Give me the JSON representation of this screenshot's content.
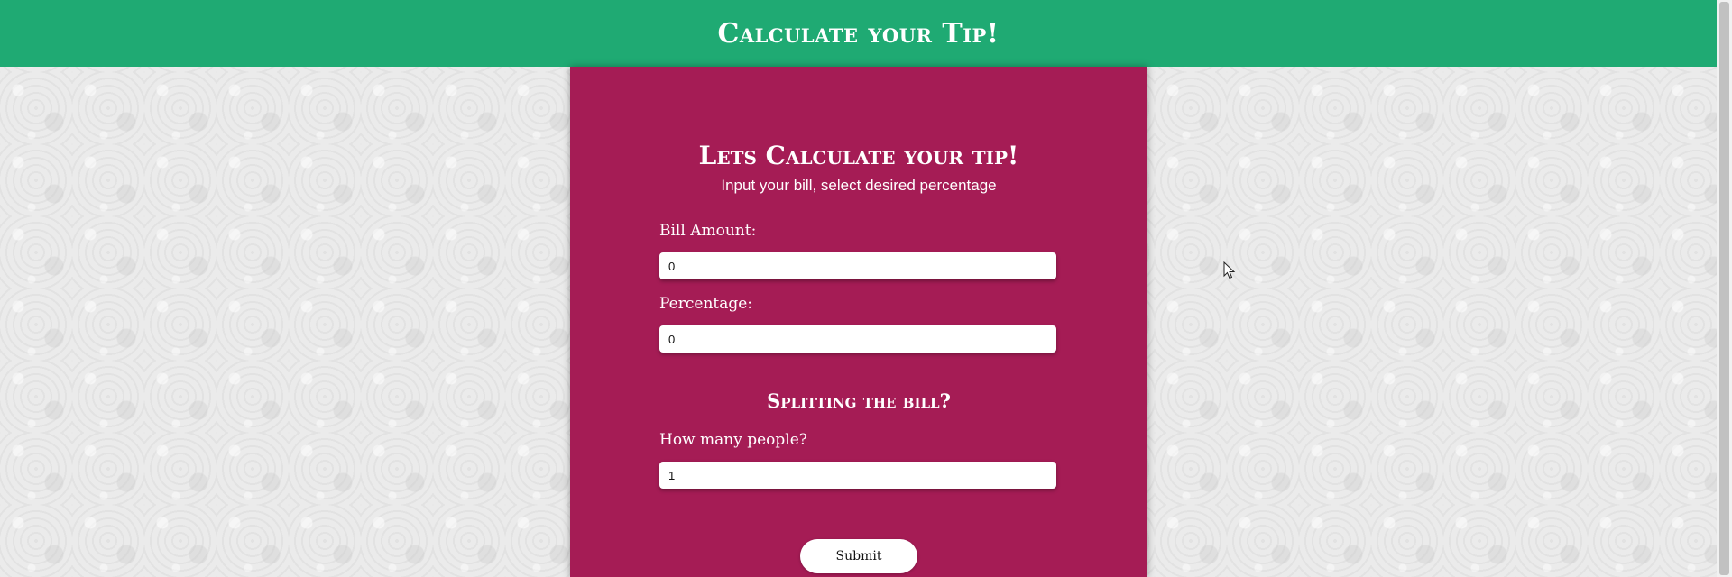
{
  "header": {
    "title": "Calculate your Tip!"
  },
  "card": {
    "title": "Lets Calculate your tip!",
    "subtitle": "Input your bill, select desired percentage",
    "bill_label": "Bill Amount:",
    "bill_value": "0",
    "percentage_label": "Percentage:",
    "percentage_value": "0",
    "split_title": "Splitting the bill?",
    "people_label": "How many people?",
    "people_value": "1",
    "submit_label": "Submit"
  },
  "colors": {
    "header": "#1faa73",
    "card": "#a51c55",
    "background": "#ebebeb"
  },
  "icons": {
    "cursor": "mouse-pointer-icon"
  }
}
